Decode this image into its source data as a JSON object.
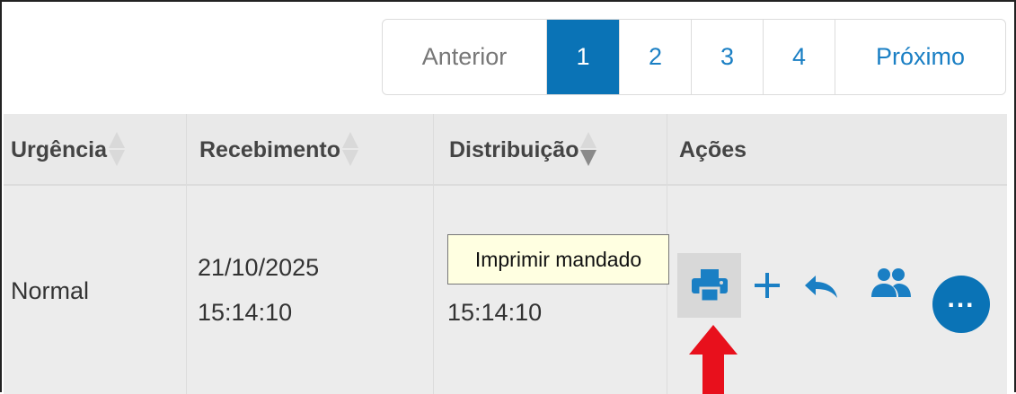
{
  "pagination": {
    "prev_label": "Anterior",
    "pages": [
      "1",
      "2",
      "3",
      "4"
    ],
    "active_page": "1",
    "next_label": "Próximo"
  },
  "table": {
    "headers": {
      "urgencia": "Urgência",
      "recebimento": "Recebimento",
      "distribuicao": "Distribuição",
      "acoes": "Ações"
    },
    "row": {
      "urgencia": "Normal",
      "recebimento_date": "21/10/2025",
      "recebimento_time": "15:14:10",
      "distribuicao_time": "15:14:10"
    }
  },
  "actions": {
    "icons": [
      "print-icon",
      "plus-icon",
      "undo-icon",
      "users-icon",
      "more-icon"
    ],
    "tooltip": "Imprimir mandado"
  },
  "colors": {
    "accent": "#0a73b6",
    "icon": "#1a7fc4",
    "arrow": "#e8101c",
    "tooltip_bg": "#ffffe1"
  }
}
